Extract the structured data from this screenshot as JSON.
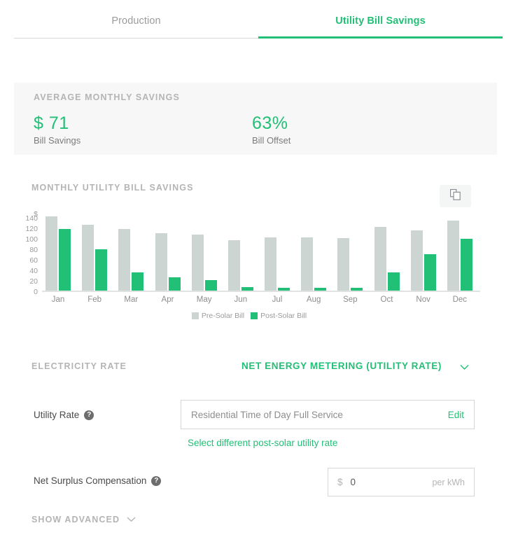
{
  "tabs": [
    {
      "label": "Production",
      "active": false
    },
    {
      "label": "Utility Bill Savings",
      "active": true
    }
  ],
  "summary": {
    "title": "AVERAGE MONTHLY SAVINGS",
    "metrics": [
      {
        "value": "$ 71",
        "label": "Bill Savings"
      },
      {
        "value": "63%",
        "label": "Bill Offset"
      }
    ]
  },
  "chart_section": {
    "title": "MONTHLY UTILITY BILL SAVINGS",
    "copy_icon": "copy-icon"
  },
  "chart_data": {
    "type": "bar",
    "title": "MONTHLY UTILITY BILL SAVINGS",
    "xlabel": "",
    "ylabel": "$",
    "ylim": [
      0,
      140
    ],
    "yticks": [
      140,
      120,
      100,
      80,
      60,
      40,
      20,
      0
    ],
    "grid": false,
    "legend_position": "bottom",
    "categories": [
      "Jan",
      "Feb",
      "Mar",
      "Apr",
      "May",
      "Jun",
      "Jul",
      "Aug",
      "Sep",
      "Oct",
      "Nov",
      "Dec"
    ],
    "series": [
      {
        "name": "Pre-Solar Bill",
        "color": "#ccd5d1",
        "values": [
          141,
          126,
          118,
          109,
          107,
          96,
          101,
          101,
          100,
          122,
          115,
          133
        ]
      },
      {
        "name": "Post-Solar Bill",
        "color": "#22bf76",
        "values": [
          118,
          79,
          35,
          25,
          20,
          7,
          6,
          6,
          5,
          35,
          69,
          99
        ]
      }
    ]
  },
  "electricity_rate": {
    "label": "ELECTRICITY RATE",
    "value": "NET ENERGY METERING (UTILITY RATE)",
    "chevron": "chevron-down-icon"
  },
  "utility_rate": {
    "label": "Utility Rate",
    "help": "?",
    "value": "Residential Time of Day Full Service",
    "edit_label": "Edit",
    "sub_link": "Select different post-solar utility rate"
  },
  "net_surplus": {
    "label": "Net Surplus Compensation",
    "help": "?",
    "currency": "$",
    "value": "0",
    "unit": "per kWh"
  },
  "show_advanced": {
    "label": "SHOW ADVANCED",
    "chevron": "chevron-down-icon"
  },
  "colors": {
    "accent_green": "#22bf76",
    "bar_gray": "#ccd5d1",
    "card_bg": "#f7f7f7",
    "muted_text": "#b4b4b4"
  }
}
